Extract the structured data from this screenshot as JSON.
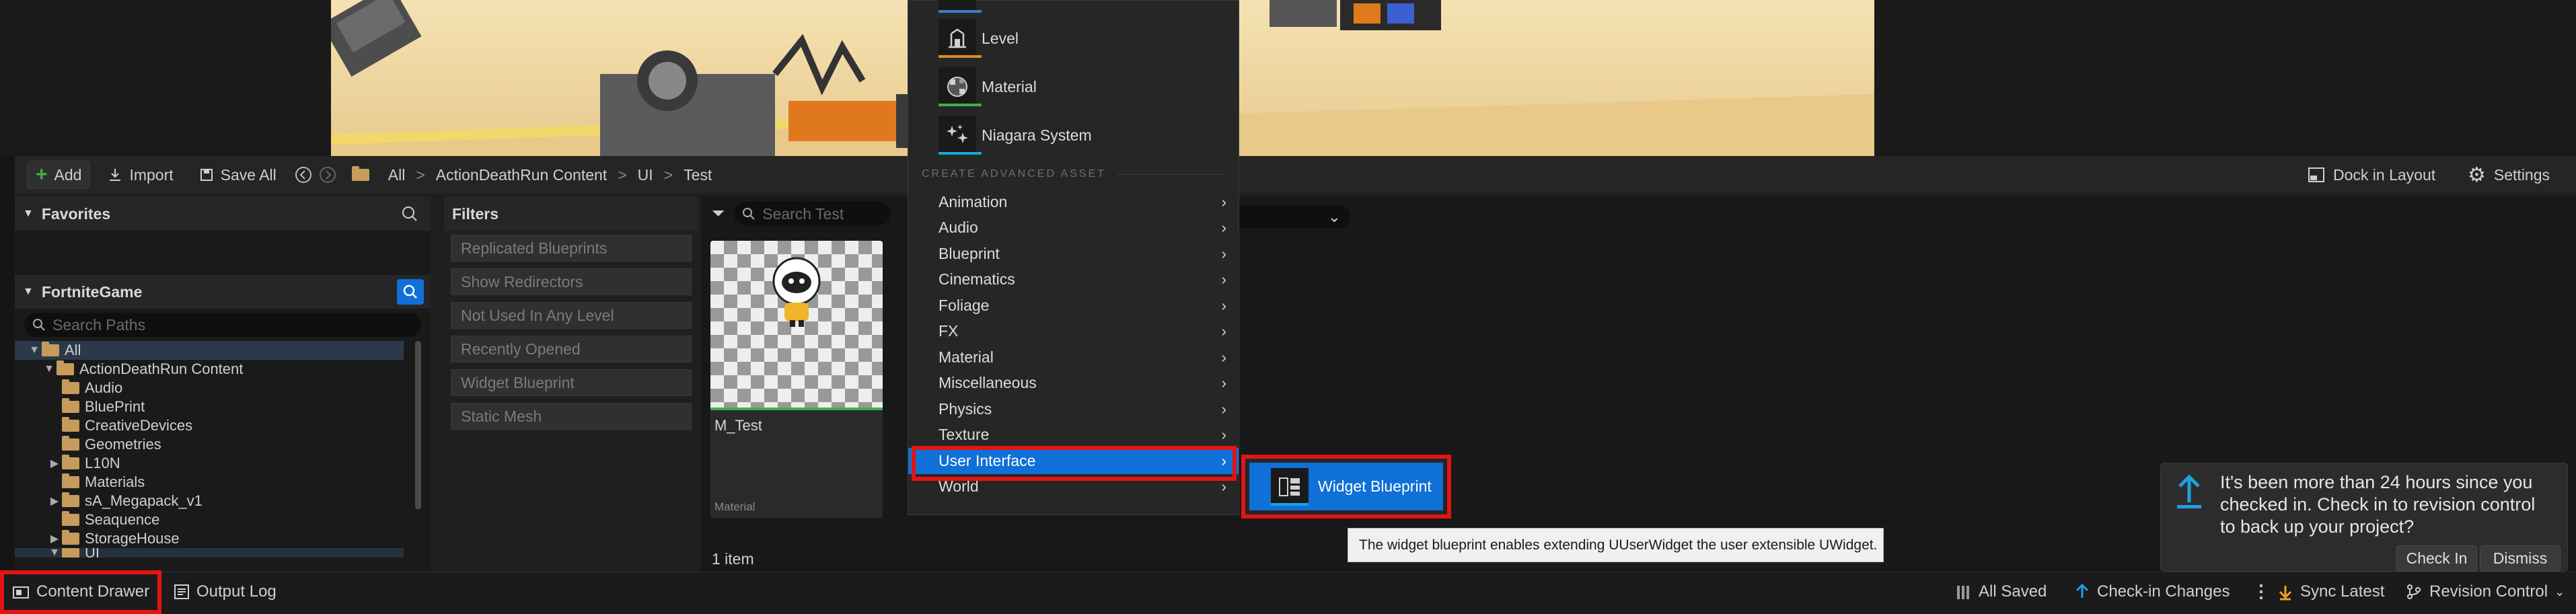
{
  "toolbar": {
    "add_label": "Add",
    "import_label": "Import",
    "save_all_label": "Save All",
    "breadcrumb": [
      "All",
      "ActionDeathRun Content",
      "UI",
      "Test"
    ],
    "dock_label": "Dock in Layout",
    "settings_label": "Settings"
  },
  "favorites": {
    "title": "Favorites"
  },
  "project": {
    "title": "FortniteGame",
    "search_placeholder": "Search Paths",
    "tree": [
      {
        "label": "All"
      },
      {
        "label": "ActionDeathRun Content"
      },
      {
        "label": "Audio"
      },
      {
        "label": "BluePrint"
      },
      {
        "label": "CreativeDevices"
      },
      {
        "label": "Geometries"
      },
      {
        "label": "L10N"
      },
      {
        "label": "Materials"
      },
      {
        "label": "sA_Megapack_v1"
      },
      {
        "label": "Seaquence"
      },
      {
        "label": "StorageHouse"
      },
      {
        "label": "UI"
      }
    ]
  },
  "filters": {
    "title": "Filters",
    "items": [
      "Replicated Blueprints",
      "Show Redirectors",
      "Not Used In Any Level",
      "Recently Opened",
      "Widget Blueprint",
      "Static Mesh"
    ]
  },
  "assets": {
    "search_placeholder": "Search Test",
    "tiles": [
      {
        "name": "M_Test",
        "type": "Material"
      }
    ],
    "count_label": "1 item"
  },
  "menu": {
    "basic_assets": [
      {
        "label": "Level",
        "icon": "level-icon",
        "color": "#e08a1e"
      },
      {
        "label": "Material",
        "icon": "material-icon",
        "color": "#3fb04a"
      },
      {
        "label": "Niagara System",
        "icon": "niagara-icon",
        "color": "#1ea0e0"
      }
    ],
    "advanced_header": "CREATE ADVANCED ASSET",
    "advanced_items": [
      "Animation",
      "Audio",
      "Blueprint",
      "Cinematics",
      "Foliage",
      "FX",
      "Material",
      "Miscellaneous",
      "Physics",
      "Texture",
      "User Interface",
      "World"
    ],
    "active_item": "User Interface"
  },
  "submenu": {
    "label": "Widget Blueprint",
    "tooltip": "The widget blueprint enables extending UUserWidget the user extensible UWidget."
  },
  "notification": {
    "message": "It's been more than 24 hours since you checked in. Check in to revision control to back up your project?",
    "check_in": "Check In",
    "dismiss": "Dismiss"
  },
  "statusbar": {
    "content_drawer": "Content Drawer",
    "output_log": "Output Log",
    "all_saved": "All Saved",
    "check_in_changes": "Check-in Changes",
    "sync_latest": "Sync Latest",
    "revision_control": "Revision Control"
  },
  "colors": {
    "accent": "#0f70d7",
    "highlight": "#e31414"
  }
}
